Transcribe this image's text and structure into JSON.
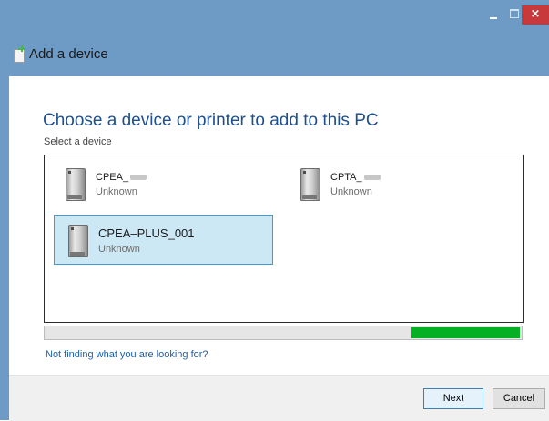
{
  "window": {
    "controls": {
      "minimize": "–",
      "maximize": "□",
      "close": "×"
    },
    "title": "Add a device"
  },
  "main": {
    "heading": "Choose a device or printer to add to this PC",
    "subheading": "Select a device",
    "devices": [
      {
        "name": "CPEA_",
        "status": "Unknown",
        "selected": false
      },
      {
        "name": "CPTA_",
        "status": "Unknown",
        "selected": false
      },
      {
        "name": "CPEA–PLUS_001",
        "status": "Unknown",
        "selected": true
      }
    ],
    "progress": {
      "indeterminate": true,
      "color": "#06b025"
    },
    "help_link": "Not finding what you are looking for?"
  },
  "footer": {
    "next_label": "Next",
    "cancel_label": "Cancel"
  },
  "colors": {
    "titlebar": "#6e9bc6",
    "close_button": "#c7393a",
    "heading": "#1e4f8f",
    "selection": "#cde8f5",
    "selection_border": "#3a9bd6",
    "link": "#1c5fa8"
  }
}
